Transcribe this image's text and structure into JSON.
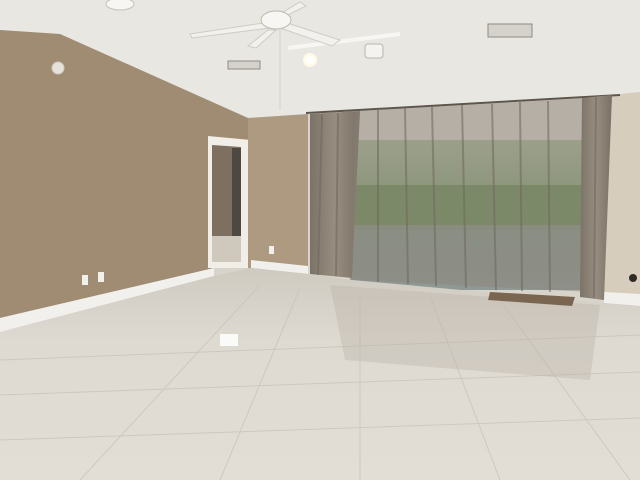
{
  "scene": {
    "kind": "photo",
    "subject": "empty-room-interior",
    "colors": {
      "ceiling": "#e9e7e2",
      "wall_left": "#a08c72",
      "wall_back": "#ad9a80",
      "wall_right": "#d7cdbd",
      "baseboard": "#f2f0ec",
      "floor": "#dcd8cf",
      "floor_grout": "#c9c4ba",
      "curtain": "#8c8377",
      "curtain_dark": "#6f675e",
      "window_view": "#7f9a72",
      "doorway_dark": "#5a554d"
    }
  }
}
